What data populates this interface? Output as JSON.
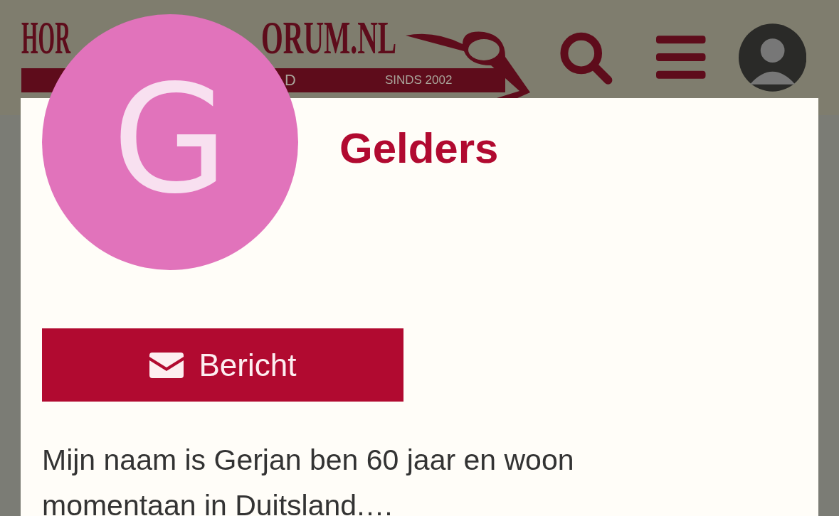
{
  "header": {
    "logo": {
      "title_parts": [
        "HOR",
        "ORUM.NL"
      ],
      "tagline": "D",
      "since": "SINDS 2002"
    }
  },
  "profile": {
    "initial": "G",
    "name": "Gelders",
    "message_button": "Bericht",
    "bio": "Mijn naam is Gerjan ben 60 jaar en woon momentaan in Duitsland.…"
  }
}
